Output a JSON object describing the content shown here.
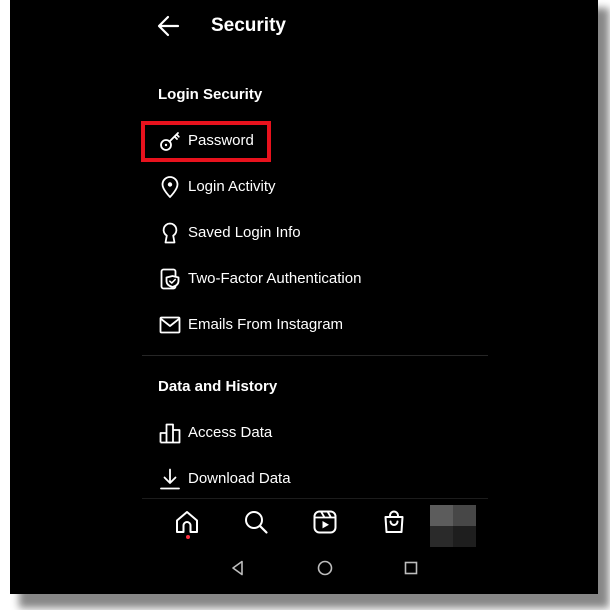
{
  "header": {
    "title": "Security"
  },
  "sections": {
    "login_security": {
      "title": "Login Security",
      "items": [
        {
          "label": "Password",
          "icon": "key-icon",
          "highlighted": true
        },
        {
          "label": "Login Activity",
          "icon": "location-pin-icon"
        },
        {
          "label": "Saved Login Info",
          "icon": "keyhole-icon"
        },
        {
          "label": "Two-Factor Authentication",
          "icon": "shield-phone-icon"
        },
        {
          "label": "Emails From Instagram",
          "icon": "envelope-icon"
        }
      ]
    },
    "data_history": {
      "title": "Data and History",
      "items": [
        {
          "label": "Access Data",
          "icon": "bar-chart-icon"
        },
        {
          "label": "Download Data",
          "icon": "download-icon"
        }
      ]
    }
  },
  "bottom_nav": {
    "items": [
      "home-icon",
      "search-icon",
      "reels-icon",
      "shop-bag-icon",
      "profile-avatar"
    ],
    "active": "home-icon"
  },
  "system_nav": {
    "items": [
      "back-triangle-icon",
      "home-circle-icon",
      "recents-square-icon"
    ]
  },
  "colors": {
    "background": "#000000",
    "text": "#ffffff",
    "highlight_box": "#e8121d",
    "notification_dot": "#ff3040"
  }
}
